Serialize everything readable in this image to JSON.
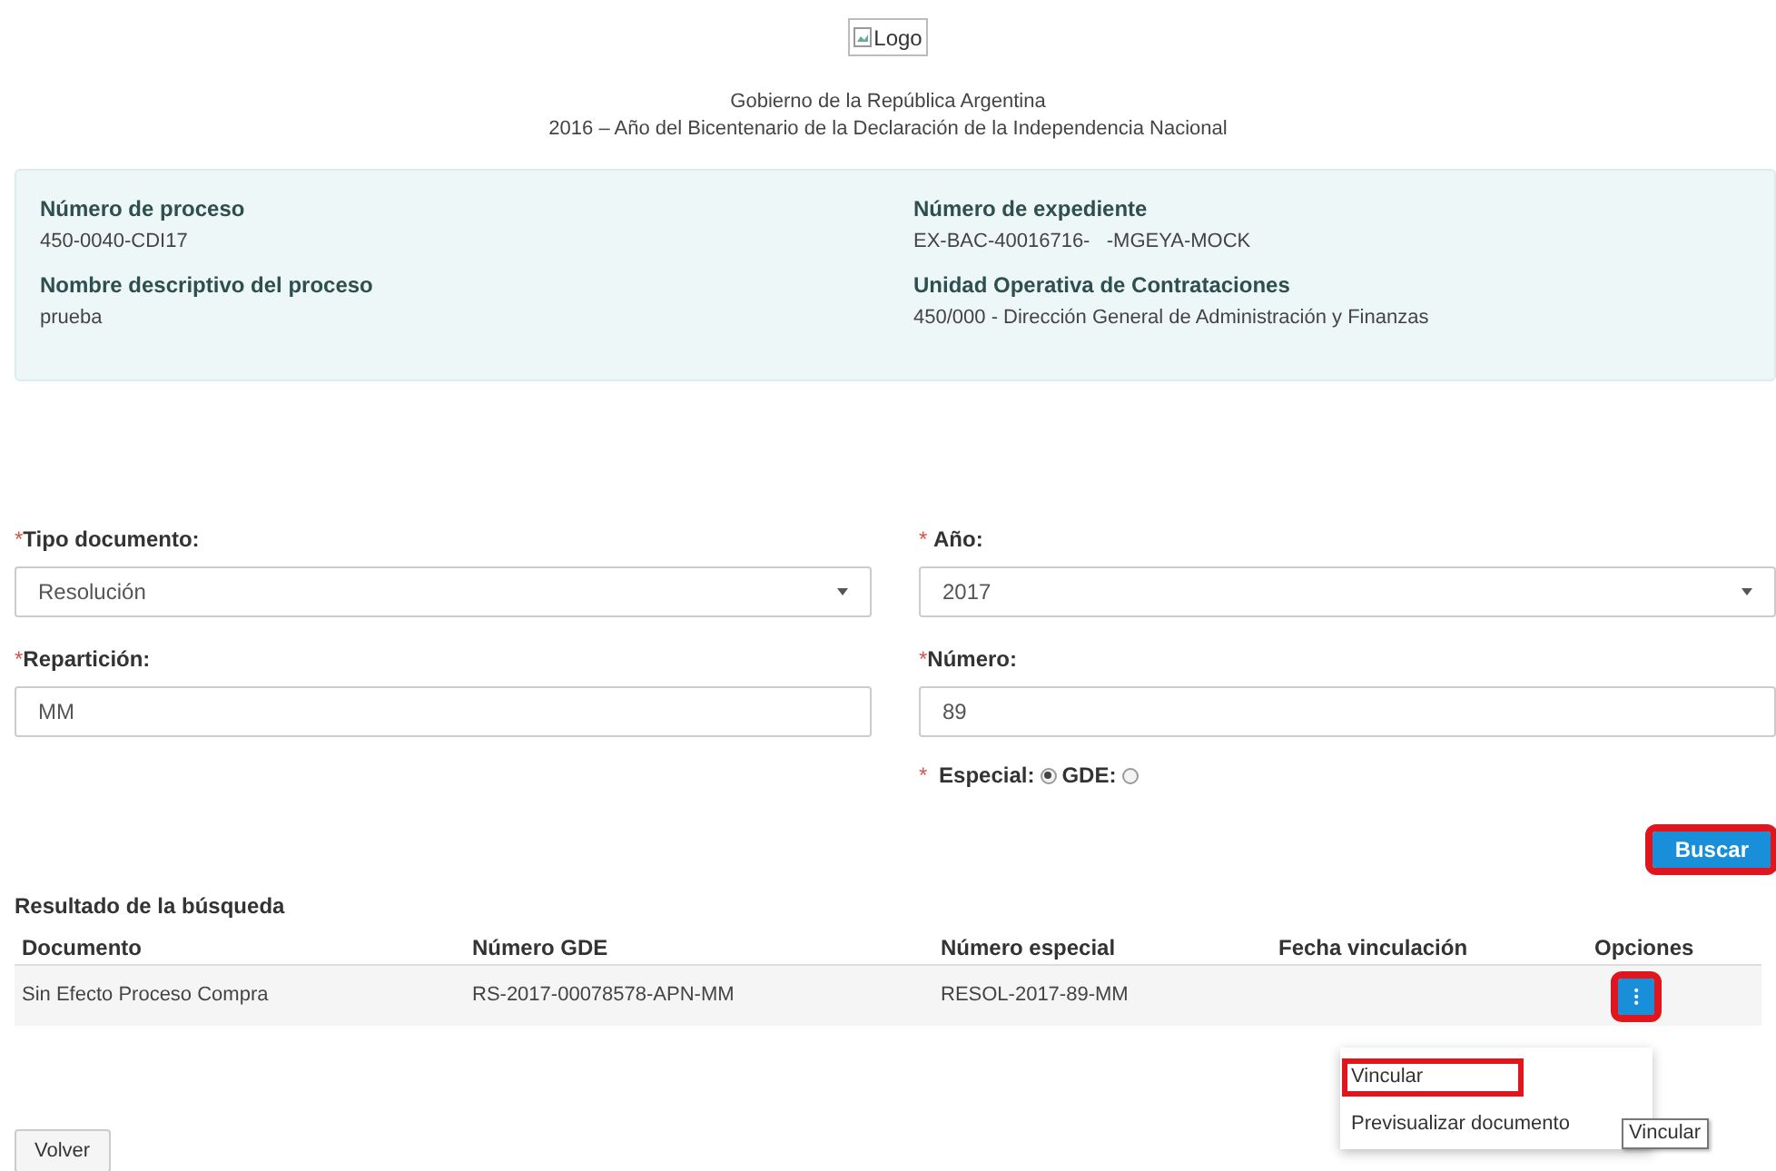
{
  "header": {
    "logo_alt": "Logo",
    "lines": [
      "Gobierno de la República Argentina",
      "2016 – Año del Bicentenario de la Declaración de la Independencia Nacional"
    ]
  },
  "info_panel": {
    "fields": [
      {
        "label": "Número de proceso",
        "value": "450-0040-CDI17"
      },
      {
        "label": "Número de expediente",
        "value": "EX-BAC-40016716-   -MGEYA-MOCK"
      },
      {
        "label": "Nombre descriptivo del proceso",
        "value": "prueba"
      },
      {
        "label": "Unidad Operativa de Contrataciones",
        "value": "450/000 - Dirección General de Administración y Finanzas"
      }
    ]
  },
  "form": {
    "fields": [
      {
        "kind": "select",
        "required_mark": "*",
        "label": "Tipo documento:",
        "value": "Resolución"
      },
      {
        "kind": "select",
        "required_mark": "* ",
        "label": "Año:",
        "value": "2017"
      },
      {
        "kind": "input",
        "required_mark": "*",
        "label": "Repartición:",
        "value": "MM"
      },
      {
        "kind": "input",
        "required_mark": "*",
        "label": "Número:",
        "value": "89"
      }
    ],
    "radio_group": {
      "required_mark": "* ",
      "options": [
        {
          "label": "Especial:",
          "selected": true
        },
        {
          "label": "GDE:",
          "selected": false
        }
      ]
    },
    "search_button": {
      "label": "Buscar",
      "highlighted": true
    }
  },
  "results": {
    "title": "Resultado de la búsqueda",
    "columns": [
      "Documento",
      "Número GDE",
      "Número especial",
      "Fecha vinculación",
      "Opciones"
    ],
    "rows": [
      {
        "cells": [
          "Sin Efecto Proceso Compra",
          "RS-2017-00078578-APN-MM",
          "RESOL-2017-89-MM",
          ""
        ],
        "options_button": {
          "label": "⁝",
          "highlighted": true
        }
      }
    ]
  },
  "menu": {
    "items": [
      {
        "label": "Vincular",
        "highlighted": true
      },
      {
        "label": "Previsualizar documento",
        "highlighted": false
      }
    ]
  },
  "tooltip": "Vincular",
  "back_button": "Volver"
}
